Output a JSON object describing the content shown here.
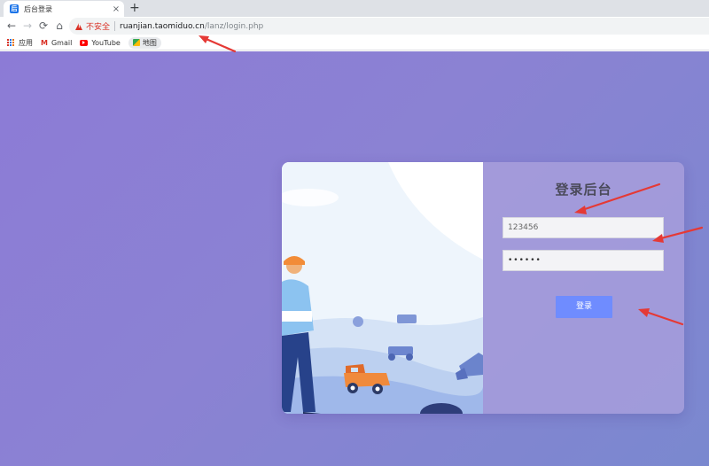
{
  "browser": {
    "tab_title": "后台登录",
    "tab_close": "×",
    "new_tab": "+",
    "nav": {
      "back": "←",
      "forward": "→",
      "reload": "⟳",
      "home": "⌂"
    },
    "security_label": "不安全",
    "url_host": "ruanjian.taomiduo.cn",
    "url_path": "/lanz/login.php",
    "bookmarks": [
      {
        "label": "应用",
        "icon": "apps-icon"
      },
      {
        "label": "Gmail",
        "icon": "gmail-icon",
        "glyph": "M"
      },
      {
        "label": "YouTube",
        "icon": "youtube-icon"
      },
      {
        "label": "地图",
        "icon": "maps-icon"
      }
    ]
  },
  "login": {
    "title": "登录后台",
    "username_value": "123456",
    "password_value": "••••••",
    "submit_label": "登录"
  },
  "colors": {
    "page_gradient_start": "#8c7bd6",
    "page_gradient_end": "#7a88cf",
    "button": "#6f8cff",
    "annotation_arrow": "#e53935"
  }
}
